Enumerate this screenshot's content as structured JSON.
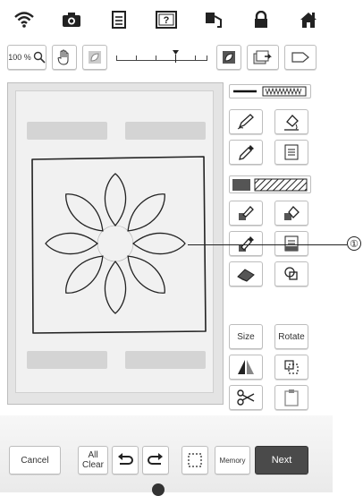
{
  "toolbar": {
    "zoom_label": "100 %",
    "icons": [
      "wifi-icon",
      "camera-icon",
      "page-icon",
      "help-icon",
      "thread-icon",
      "lock-icon",
      "home-icon"
    ]
  },
  "tools": {
    "size_label": "Size",
    "rotate_label": "Rotate"
  },
  "footer": {
    "cancel_label": "Cancel",
    "all_clear_label_line1": "All",
    "all_clear_label_line2": "Clear",
    "memory_label": "Memory",
    "next_label": "Next"
  },
  "callout": {
    "number": "①"
  },
  "colors": {
    "pen": "#222222",
    "next_bg": "#4a4a4a",
    "accent": "#6a6a6a"
  }
}
